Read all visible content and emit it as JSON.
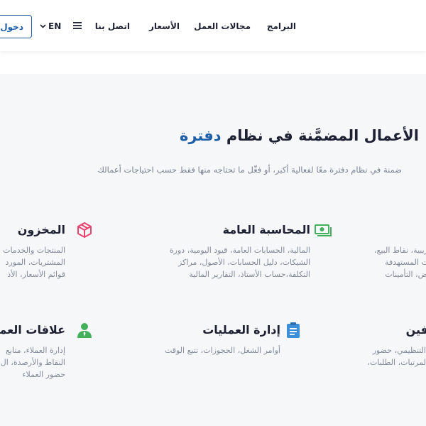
{
  "header": {
    "login_label": "دخول",
    "language_label": "EN",
    "menu_icon": "hamburger-icon",
    "nav": [
      {
        "label": "البرامج"
      },
      {
        "label": "مجالات العمل"
      },
      {
        "label": "الأسعار"
      },
      {
        "label": "اتصل بنا"
      }
    ]
  },
  "hero": {
    "headline_prefix": "الأعمال المضمَّنة في نظام ",
    "headline_brand": "دفترة",
    "subheadline": "ضمنة في نظام دفترة معًا لفعالية أكبر، أو فعِّل ما تحتاجه منها فقط حسب احتياجات أعمالك"
  },
  "modules": [
    {
      "title": "المحاسبة العامة",
      "icon": "money-icon",
      "icon_color": "#43b05c",
      "lines": [
        "المالية، الحسابات العامة، قيود اليومية، دورة",
        "الشيكات، دليل الحسابات، الأصول، مراكز",
        "التكلفة،حساب الأستاذ، التقارير المالية"
      ]
    },
    {
      "title": "المخزون",
      "icon": "box-icon",
      "icon_color": "#e8426f",
      "lines": [
        "المنتجات والخدمات",
        "المشتريات، المورد",
        "قوائم الأسعار، الأذ"
      ]
    },
    {
      "title": "",
      "icon": "",
      "lines": [
        "والضريبية، نقاط البيع،",
        "مبيعات المستهدفة",
        "العروض، التأمينات"
      ]
    },
    {
      "title": "إدارة العمليات",
      "icon": "clipboard-icon",
      "icon_color": "#3b8fd9",
      "lines": [
        "أوامر الشغل، الحجوزات، تتبع الوقت"
      ]
    },
    {
      "title": "علاقات العملا",
      "icon": "user-icon",
      "icon_color": "#43b05c",
      "lines": [
        "إدارة العملاء، متابع",
        "النقاط والأرصدة، ال",
        "حضور العملاء"
      ]
    },
    {
      "title": "فين",
      "icon": "",
      "lines": [
        "التنظيمي، حضور",
        "لمرتبات، الطلبات،"
      ]
    }
  ],
  "colors": {
    "brand_blue": "#1f5fa9",
    "section_background": "#f5f7f9",
    "text_dark": "#1e2133",
    "text_muted": "#858b9a"
  }
}
